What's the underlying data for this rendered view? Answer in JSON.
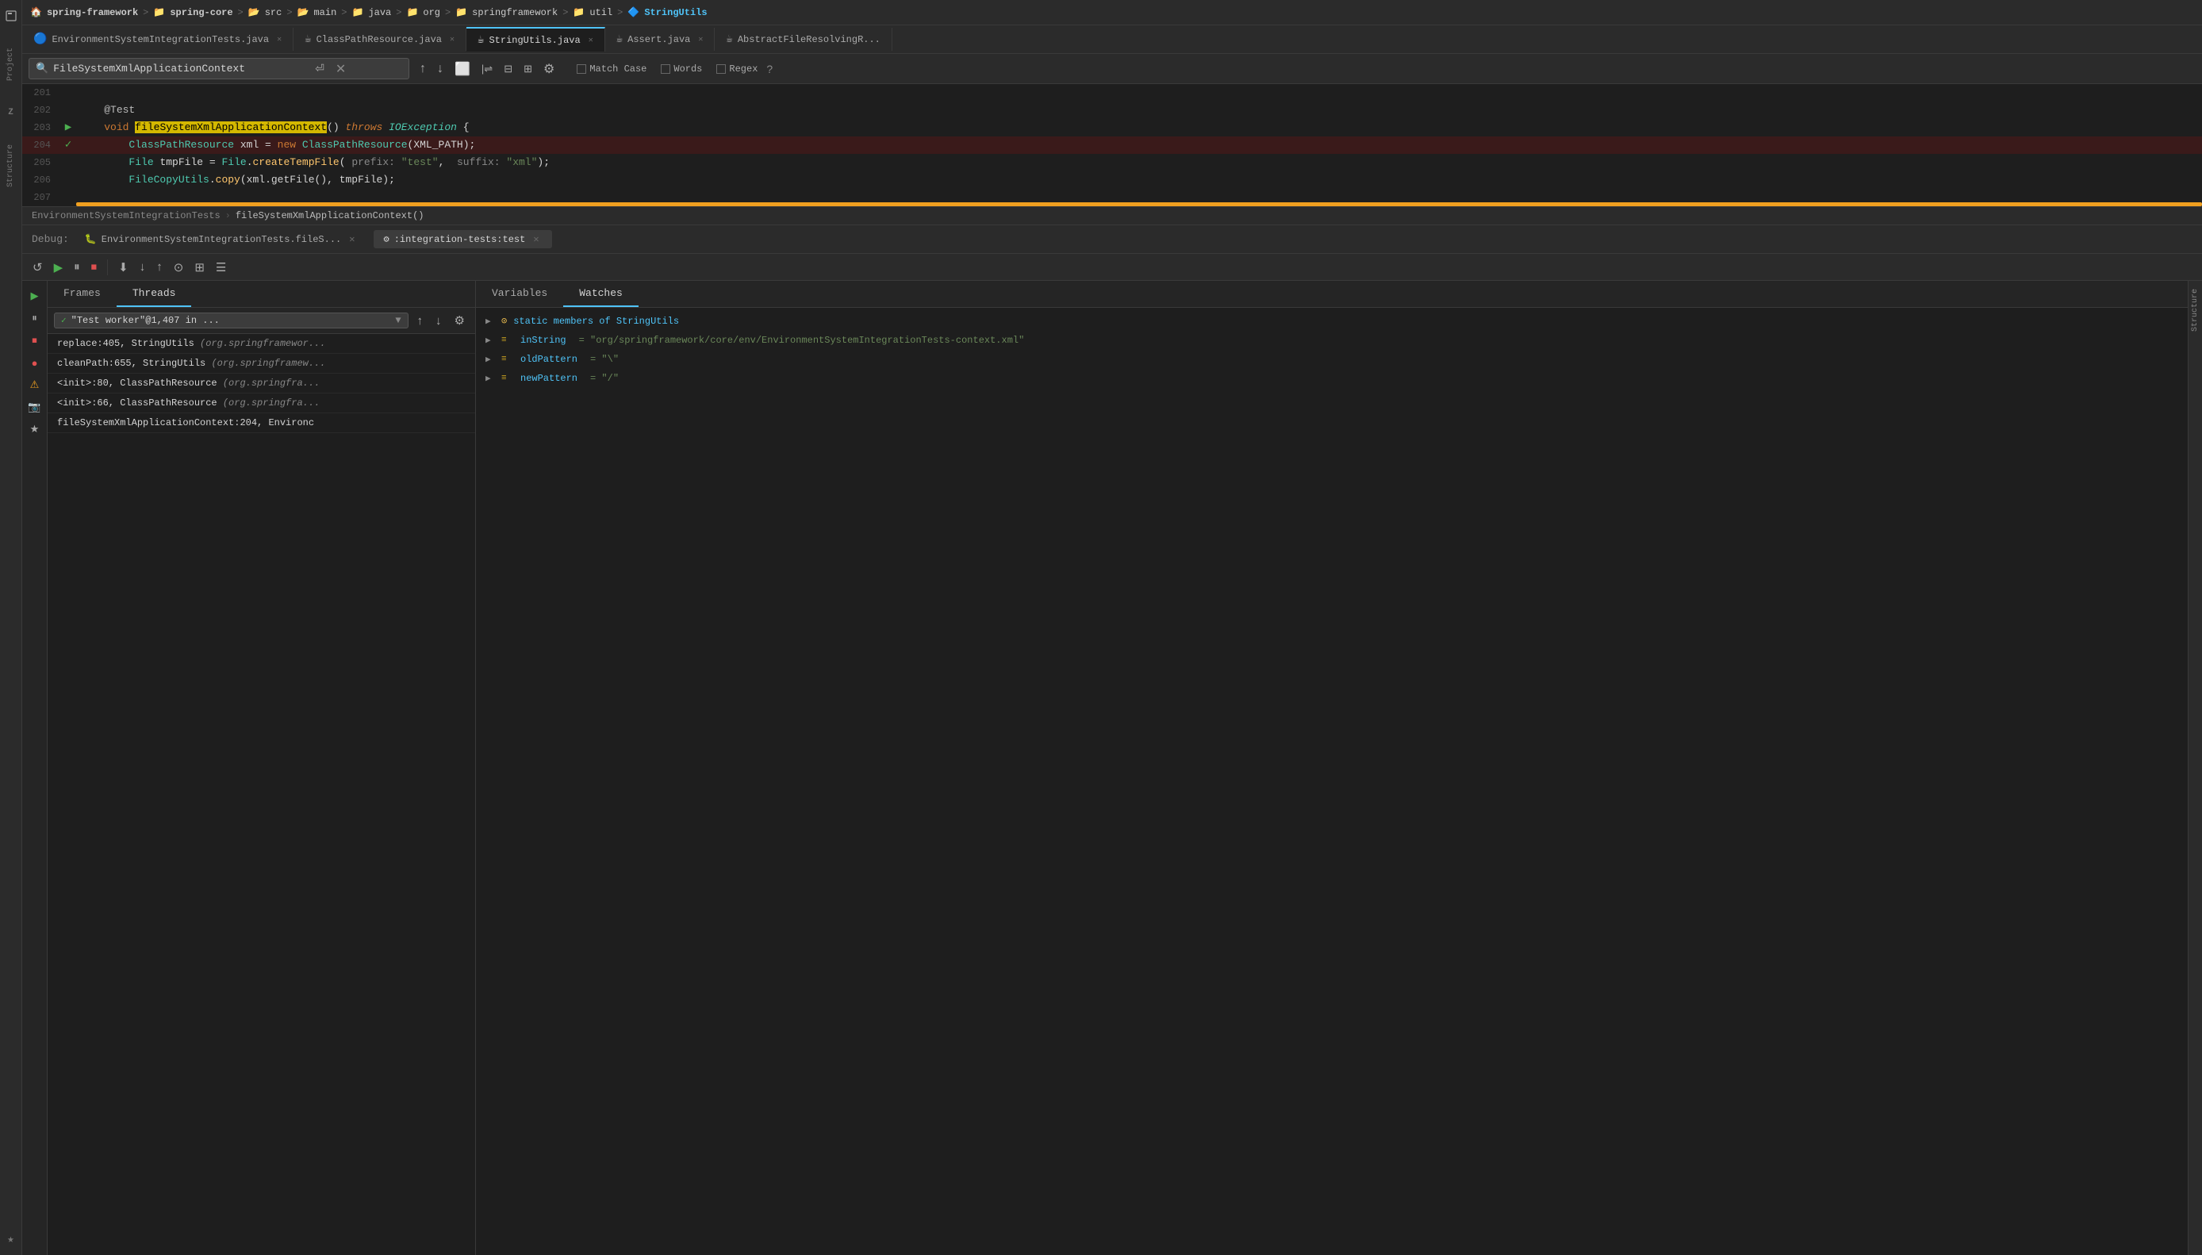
{
  "titlebar": {
    "items": [
      {
        "label": "spring-framework",
        "icon": "🏠"
      },
      {
        "sep": ">"
      },
      {
        "label": "spring-core",
        "icon": "📁"
      },
      {
        "sep": ">"
      },
      {
        "label": "src",
        "icon": "📂"
      },
      {
        "sep": ">"
      },
      {
        "label": "main",
        "icon": "📂"
      },
      {
        "sep": ">"
      },
      {
        "label": "java",
        "icon": "📁"
      },
      {
        "sep": ">"
      },
      {
        "label": "org",
        "icon": "📁"
      },
      {
        "sep": ">"
      },
      {
        "label": "springframework",
        "icon": "📁"
      },
      {
        "sep": ">"
      },
      {
        "label": "util",
        "icon": "📁"
      },
      {
        "sep": ">"
      },
      {
        "label": "StringUtils",
        "icon": "🔷",
        "active": true
      }
    ]
  },
  "tabs": [
    {
      "label": "EnvironmentSystemIntegrationTests.java",
      "icon": "🔵",
      "active": false
    },
    {
      "label": "ClassPathResource.java",
      "icon": "☕",
      "active": false
    },
    {
      "label": "StringUtils.java",
      "icon": "☕",
      "active": true
    },
    {
      "label": "Assert.java",
      "icon": "☕",
      "active": false
    },
    {
      "label": "AbstractFileResolvingR...",
      "icon": "☕",
      "active": false
    }
  ],
  "search": {
    "query": "FileSystemXmlApplicationContext",
    "placeholder": "Search",
    "match_case_label": "Match Case",
    "words_label": "Words",
    "regex_label": "Regex"
  },
  "code": {
    "lines": [
      {
        "num": "201",
        "content": "",
        "type": "empty"
      },
      {
        "num": "202",
        "content": "    @Test",
        "type": "annot"
      },
      {
        "num": "203",
        "content": "    void fileSystemXmlApplicationContext() throws IOException {",
        "type": "code",
        "hasPlay": true
      },
      {
        "num": "204",
        "content": "        ClassPathResource xml = new ClassPathResource(XML_PATH);",
        "type": "code-hl",
        "hasCheck": true
      },
      {
        "num": "205",
        "content": "        File tmpFile = File.createTempFile( prefix: \"test\",  suffix: \"xml\");",
        "type": "code"
      },
      {
        "num": "206",
        "content": "        FileCopyUtils.copy(xml.getFile(), tmpFile);",
        "type": "code"
      },
      {
        "num": "207",
        "content": "",
        "type": "orange-bar"
      }
    ],
    "breadcrumb_class": "EnvironmentSystemIntegrationTests",
    "breadcrumb_method": "fileSystemXmlApplicationContext()"
  },
  "debug": {
    "label": "Debug:",
    "tabs": [
      {
        "label": "EnvironmentSystemIntegrationTests.fileS...",
        "icon": "🐛",
        "active": false
      },
      {
        "label": ":integration-tests:test",
        "icon": "⚙",
        "active": true
      }
    ],
    "toolbar_buttons": [
      "↺",
      "▶",
      "⏸",
      "⏹",
      "●",
      "🔴",
      "🟠",
      "📷",
      "⋮"
    ],
    "left_panel": {
      "tabs": [
        {
          "label": "Frames",
          "active": false
        },
        {
          "label": "Threads",
          "active": true
        }
      ],
      "thread": "\"Test worker\"@1,407 in ...",
      "frames": [
        {
          "fn": "replace:405, StringUtils",
          "loc": "(org.springframewor..."
        },
        {
          "fn": "cleanPath:655, StringUtils",
          "loc": "(org.springframew..."
        },
        {
          "fn": "<init>:80, ClassPathResource",
          "loc": "(org.springfra..."
        },
        {
          "fn": "<init>:66, ClassPathResource",
          "loc": "(org.springfra..."
        },
        {
          "fn": "fileSystemXmlApplicationContext:204, Environc",
          "loc": ""
        }
      ]
    },
    "right_panel": {
      "tabs": [
        {
          "label": "Variables",
          "active": false
        },
        {
          "label": "Watches",
          "active": true
        }
      ],
      "variables": [
        {
          "name": "static members of StringUtils",
          "expand": true,
          "type": "static"
        },
        {
          "name": "inString",
          "value": "= \"org/springframework/core/env/EnvironmentSystemIntegrationTests-context.xml\"",
          "expand": true
        },
        {
          "name": "oldPattern",
          "value": "= \"\\\"",
          "expand": true
        },
        {
          "name": "newPattern",
          "value": "= \"/\"",
          "expand": true
        }
      ]
    }
  },
  "sidebar": {
    "icons": [
      {
        "label": "Project",
        "icon": "📁"
      },
      {
        "label": "Z",
        "icon": "Z"
      },
      {
        "label": "Structure",
        "icon": "≡"
      },
      {
        "label": "Favorites",
        "icon": "★"
      }
    ]
  }
}
